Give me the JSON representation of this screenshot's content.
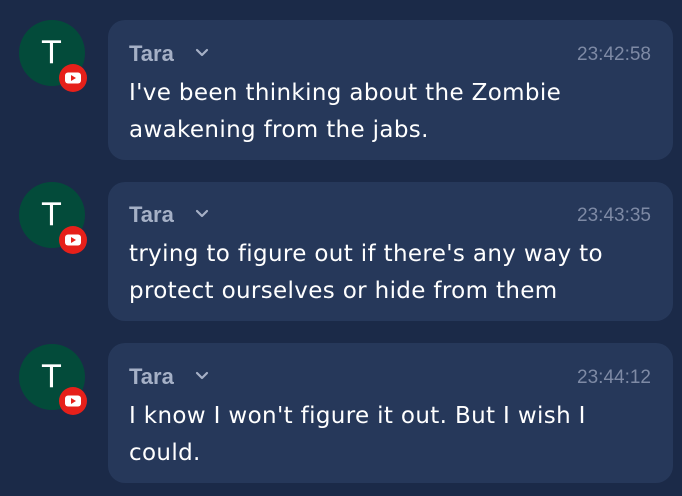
{
  "messages": [
    {
      "avatar_letter": "T",
      "author": "Tara",
      "time": "23:42:58",
      "text": "I've been thinking about the Zombie awakening from the jabs.",
      "platform_icon": "youtube-icon"
    },
    {
      "avatar_letter": "T",
      "author": "Tara",
      "time": "23:43:35",
      "text": "trying to figure out if there's any way to protect ourselves or hide from them",
      "platform_icon": "youtube-icon"
    },
    {
      "avatar_letter": "T",
      "author": "Tara",
      "time": "23:44:12",
      "text": "I know I won't figure it out. But I wish I could.",
      "platform_icon": "youtube-icon"
    }
  ],
  "colors": {
    "background": "#1b2a48",
    "bubble": "#26385a",
    "avatar": "#034b3a",
    "badge": "#e6201a",
    "author": "#a5b0c6",
    "time": "#7e8aa5",
    "text": "#ffffff"
  }
}
